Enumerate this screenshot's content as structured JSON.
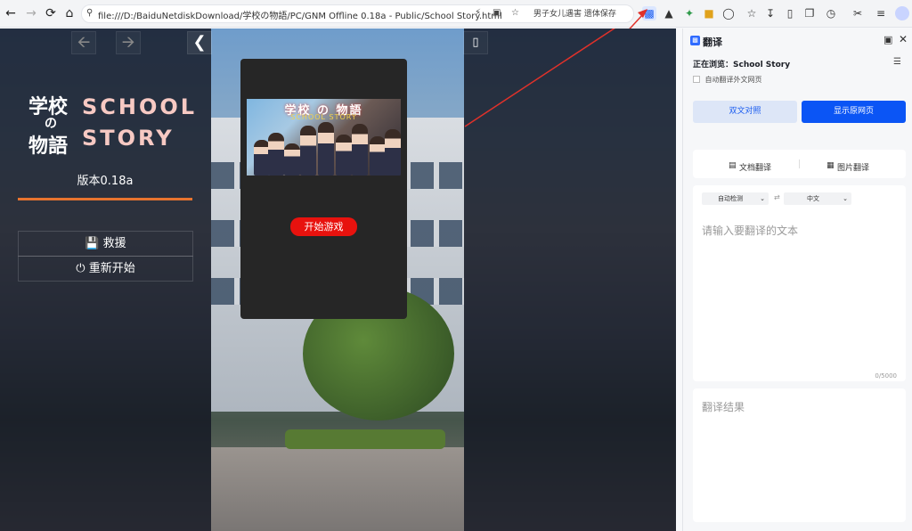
{
  "browser": {
    "url": "file:///D:/BaiduNetdiskDownload/学校の物語/PC/GNM Offline 0.18a - Public/School Story.html",
    "bookmark": "男子女儿遇害 遗体保存"
  },
  "game": {
    "logo_cn_1": "学校",
    "logo_cn_2": "の",
    "logo_cn_3": "物語",
    "logo_en_1": "SCHOOL",
    "logo_en_2": "STORY",
    "version": "版本0.18a",
    "save_label": "救援",
    "restart_label": "重新开始",
    "start_label": "开始游戏",
    "cover_title": "学校 の 物語",
    "cover_subtitle": "SCHOOL STORY"
  },
  "panel": {
    "title": "翻译",
    "browsing": "正在浏览：School Story",
    "auto_translate": "自动翻译外文网页",
    "bilingual_btn": "双文对照",
    "original_btn": "显示原网页",
    "tab_doc": "文档翻译",
    "tab_img": "图片翻译",
    "src_lang": "自动检测",
    "dst_lang": "中文",
    "input_placeholder": "请输入要翻译的文本",
    "counter": "0/5000",
    "result_placeholder": "翻译结果"
  },
  "colors": {
    "accent_orange": "#e8742f",
    "start_red": "#e8120e",
    "primary_blue": "#0b55f5",
    "annotation_arrow": "#e0312a"
  },
  "icons": [
    "back-icon",
    "forward-icon",
    "reload-icon",
    "home-icon",
    "translate-icon",
    "star-icon",
    "download-icon",
    "menu-icon",
    "save-icon",
    "power-icon",
    "close-icon"
  ]
}
